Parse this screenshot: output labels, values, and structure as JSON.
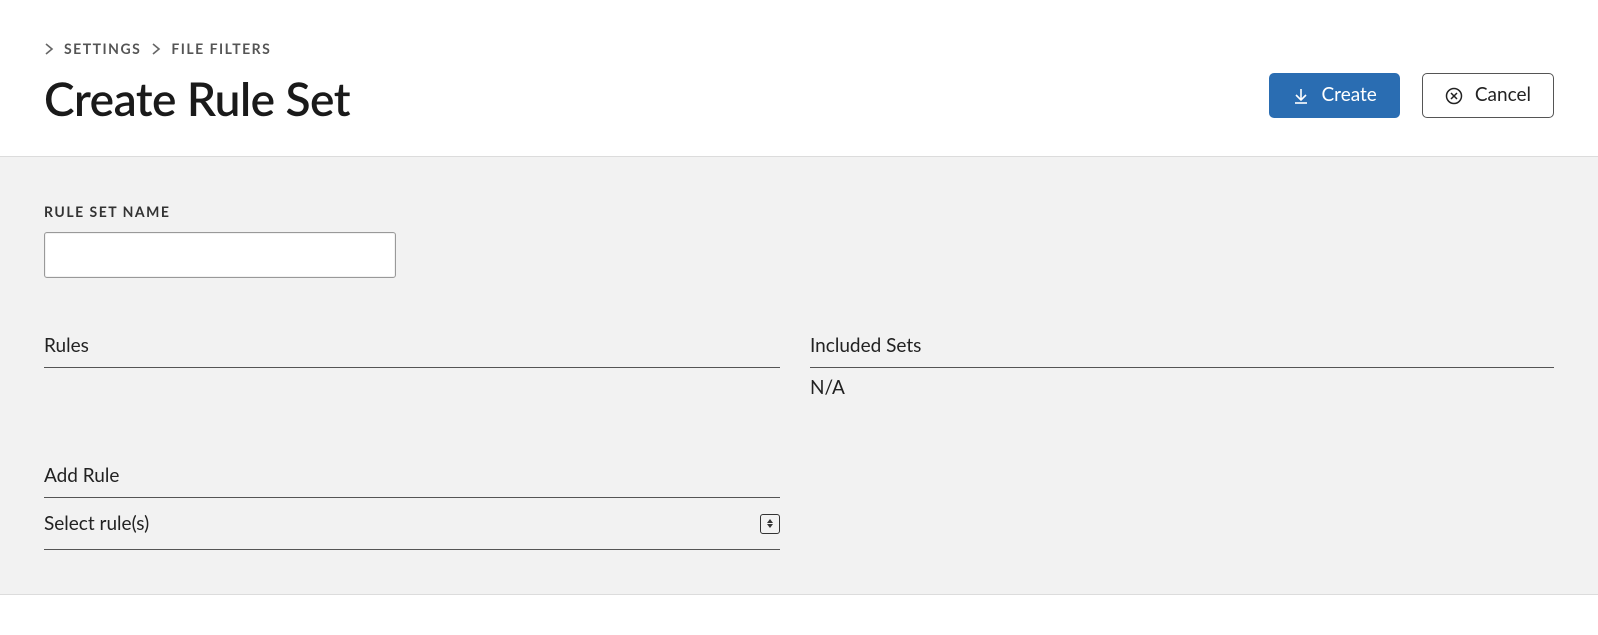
{
  "breadcrumb": {
    "items": [
      "SETTINGS",
      "FILE FILTERS"
    ]
  },
  "page": {
    "title": "Create Rule Set"
  },
  "actions": {
    "create_label": "Create",
    "cancel_label": "Cancel"
  },
  "form": {
    "rule_set_name_label": "RULE SET NAME",
    "rule_set_name_value": ""
  },
  "sections": {
    "rules_heading": "Rules",
    "included_sets_heading": "Included Sets",
    "included_sets_value": "N/A",
    "add_rule_heading": "Add Rule",
    "select_rules_placeholder": "Select rule(s)"
  }
}
